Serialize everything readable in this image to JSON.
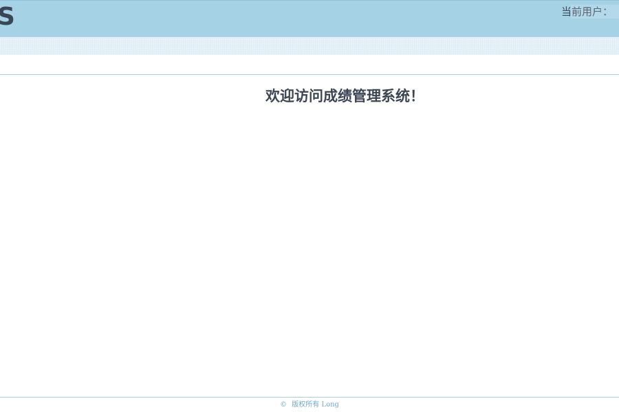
{
  "header": {
    "logo_fragment": "S",
    "user_text": "当前用户："
  },
  "main": {
    "welcome_text": "欢迎访问成绩管理系统！"
  },
  "footer": {
    "copyright_symbol": "©",
    "copyright_text": "版权所有 Long"
  },
  "colors": {
    "header_bg": "#a6d2e6",
    "nav_strip_bg": "#c9e3ef",
    "text_dark": "#3c4652",
    "footer_text": "#6fa9c8",
    "divider": "#a6d2e6"
  }
}
